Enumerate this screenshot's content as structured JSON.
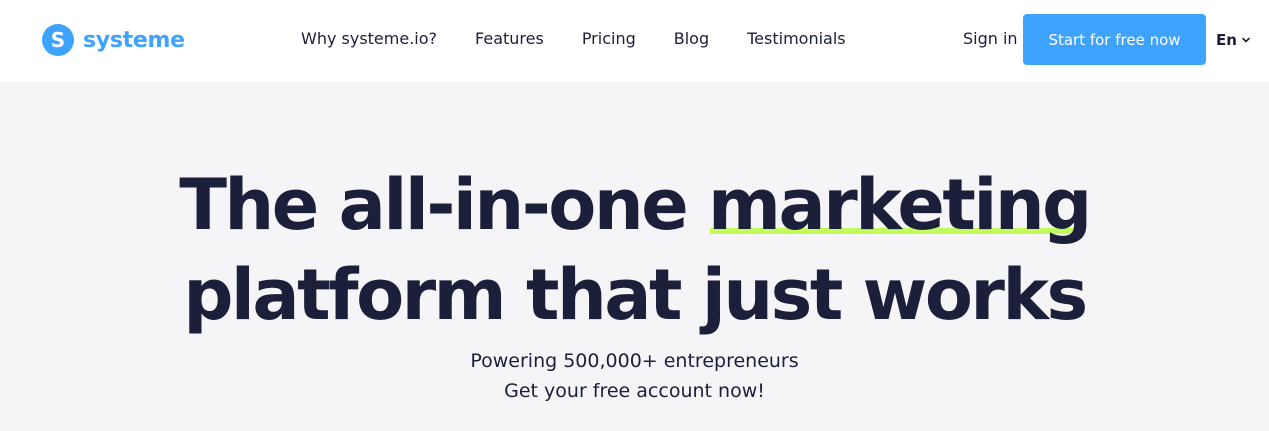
{
  "brand": {
    "mark": "S",
    "name": "systeme",
    "color": "#3ea2ff"
  },
  "nav": {
    "items": [
      {
        "label": "Why systeme.io?"
      },
      {
        "label": "Features"
      },
      {
        "label": "Pricing"
      },
      {
        "label": "Blog"
      },
      {
        "label": "Testimonials"
      }
    ]
  },
  "header": {
    "sign_in_label": "Sign in",
    "cta_label": "Start for free now",
    "language": "En",
    "language_icon": "chevron-down-icon"
  },
  "hero": {
    "title_part1": "The all-in-one ",
    "title_highlight": "marketing",
    "title_part2": "platform that just works",
    "subtitle_line1": "Powering 500,000+ entrepreneurs",
    "subtitle_line2": "Get your free account now!",
    "highlight_color": "#c3fb5c",
    "text_color": "#1c1f3a"
  }
}
